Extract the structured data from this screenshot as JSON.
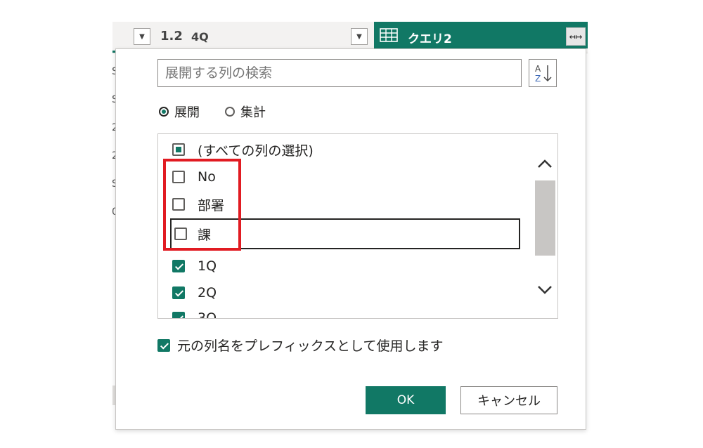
{
  "header": {
    "col1_type": "1.2",
    "col1_name": "4Q",
    "query_title": "クエリ2",
    "expand_label": "↤↦"
  },
  "background_chars": [
    "S",
    "S",
    "2",
    "2",
    "S",
    "0"
  ],
  "dialog": {
    "search_placeholder": "展開する列の検索",
    "sort_icon": "sort-az-icon",
    "mode_options": [
      {
        "label": "展開",
        "selected": true
      },
      {
        "label": "集計",
        "selected": false
      }
    ],
    "columns": [
      {
        "label": "(すべての列の選択)",
        "state": "partial"
      },
      {
        "label": "No",
        "state": "unchecked"
      },
      {
        "label": "部署",
        "state": "unchecked"
      },
      {
        "label": "課",
        "state": "unchecked"
      },
      {
        "label": "1Q",
        "state": "checked"
      },
      {
        "label": "2Q",
        "state": "checked"
      },
      {
        "label": "3Q",
        "state": "checked"
      }
    ],
    "use_prefix_label": "元の列名をプレフィックスとして使用します",
    "use_prefix_checked": true,
    "ok_label": "OK",
    "cancel_label": "キャンセル"
  },
  "colors": {
    "accent": "#117865",
    "highlight": "#e11b22"
  }
}
